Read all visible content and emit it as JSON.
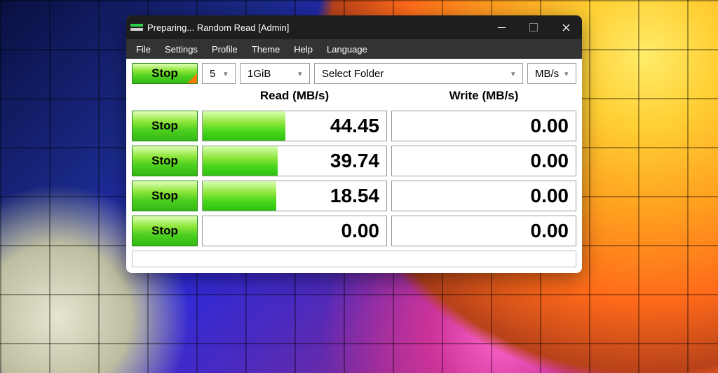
{
  "window": {
    "title": "Preparing... Random Read [Admin]"
  },
  "menubar": [
    "File",
    "Settings",
    "Profile",
    "Theme",
    "Help",
    "Language"
  ],
  "controls": {
    "master_button": "Stop",
    "runs": "5",
    "test_size": "1GiB",
    "folder": "Select Folder",
    "unit": "MB/s"
  },
  "columns": {
    "read_header": "Read (MB/s)",
    "write_header": "Write (MB/s)"
  },
  "rows": [
    {
      "button": "Stop",
      "read": "44.45",
      "read_pct": 45,
      "write": "0.00",
      "write_pct": 0
    },
    {
      "button": "Stop",
      "read": "39.74",
      "read_pct": 41,
      "write": "0.00",
      "write_pct": 0
    },
    {
      "button": "Stop",
      "read": "18.54",
      "read_pct": 40,
      "write": "0.00",
      "write_pct": 0
    },
    {
      "button": "Stop",
      "read": "0.00",
      "read_pct": 0,
      "write": "0.00",
      "write_pct": 0
    }
  ]
}
